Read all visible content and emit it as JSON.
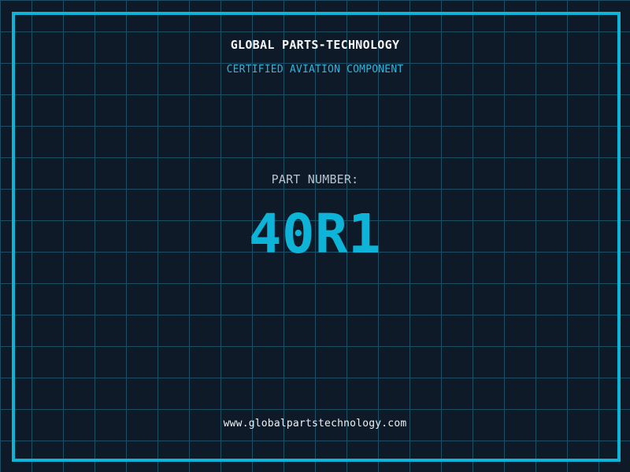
{
  "colors": {
    "background": "#0f1a29",
    "grid_line": "#1d4f66",
    "accent_cyan": "#0db4d8",
    "subtitle_cyan": "#2fb4da",
    "title_white": "#f4f6f8",
    "label_gray": "#b9c3ce",
    "footer_white": "#eef1f3"
  },
  "header": {
    "title": "GLOBAL PARTS-TECHNOLOGY",
    "subtitle": "CERTIFIED AVIATION COMPONENT"
  },
  "part": {
    "label": "PART NUMBER:",
    "value": "40R1"
  },
  "footer": {
    "website": "www.globalpartstechnology.com"
  }
}
